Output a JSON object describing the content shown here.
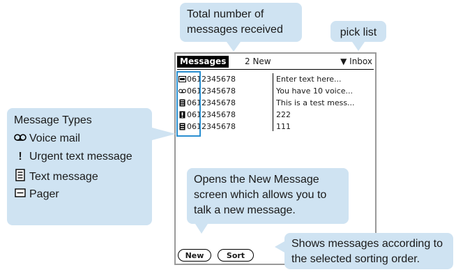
{
  "callouts": {
    "total_messages": "Total number of messages received",
    "pick_list": "pick list",
    "new_message": "Opens the New Message screen which allows you to talk a new message.",
    "sort": "Shows messages according to the selected sorting order."
  },
  "legend": {
    "title": "Message Types",
    "items": [
      {
        "icon": "voice-mail-icon",
        "label": "Voice mail"
      },
      {
        "icon": "urgent-icon",
        "label": "Urgent text message"
      },
      {
        "icon": "text-message-icon",
        "label": "Text message"
      },
      {
        "icon": "pager-icon",
        "label": "Pager"
      }
    ]
  },
  "screen": {
    "tab_title": "Messages",
    "new_count": "2 New",
    "pick_list_value": "Inbox",
    "messages": [
      {
        "type": "pager-icon",
        "number": "0612345678",
        "text": "Enter text here..."
      },
      {
        "type": "voice-mail-icon",
        "number": "0612345678",
        "text": "You have 10 voice..."
      },
      {
        "type": "text-message-icon",
        "number": "0612345678",
        "text": "This is a test mess..."
      },
      {
        "type": "urgent-icon",
        "number": "0612345678",
        "text": "222"
      },
      {
        "type": "text-message-icon",
        "number": "0612345678",
        "text": "111"
      }
    ],
    "buttons": {
      "new": "New",
      "sort": "Sort"
    }
  },
  "colors": {
    "callout": "#cfe3f2",
    "highlight": "#2a8fd0"
  }
}
